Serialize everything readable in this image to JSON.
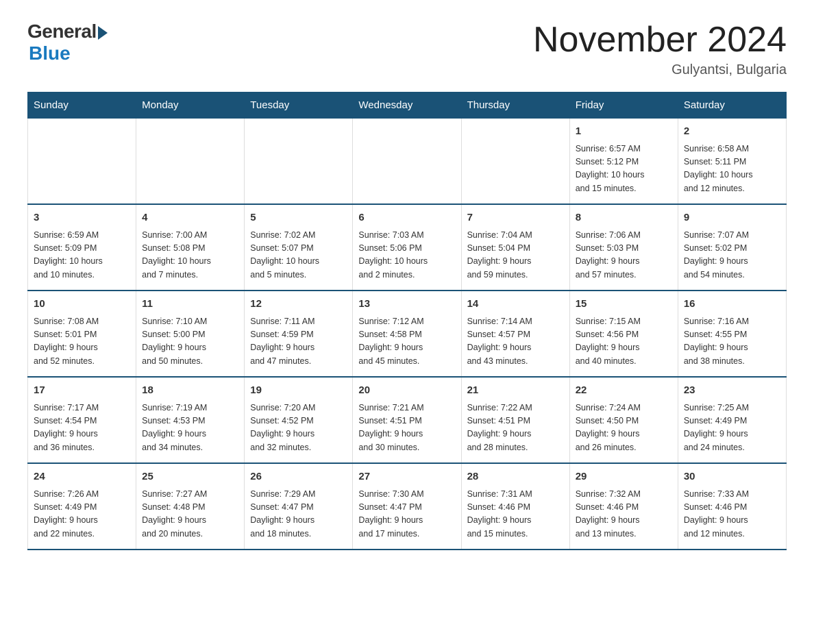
{
  "header": {
    "logo_general": "General",
    "logo_blue": "Blue",
    "title": "November 2024",
    "location": "Gulyantsi, Bulgaria"
  },
  "weekdays": [
    "Sunday",
    "Monday",
    "Tuesday",
    "Wednesday",
    "Thursday",
    "Friday",
    "Saturday"
  ],
  "weeks": [
    [
      {
        "day": "",
        "info": ""
      },
      {
        "day": "",
        "info": ""
      },
      {
        "day": "",
        "info": ""
      },
      {
        "day": "",
        "info": ""
      },
      {
        "day": "",
        "info": ""
      },
      {
        "day": "1",
        "info": "Sunrise: 6:57 AM\nSunset: 5:12 PM\nDaylight: 10 hours\nand 15 minutes."
      },
      {
        "day": "2",
        "info": "Sunrise: 6:58 AM\nSunset: 5:11 PM\nDaylight: 10 hours\nand 12 minutes."
      }
    ],
    [
      {
        "day": "3",
        "info": "Sunrise: 6:59 AM\nSunset: 5:09 PM\nDaylight: 10 hours\nand 10 minutes."
      },
      {
        "day": "4",
        "info": "Sunrise: 7:00 AM\nSunset: 5:08 PM\nDaylight: 10 hours\nand 7 minutes."
      },
      {
        "day": "5",
        "info": "Sunrise: 7:02 AM\nSunset: 5:07 PM\nDaylight: 10 hours\nand 5 minutes."
      },
      {
        "day": "6",
        "info": "Sunrise: 7:03 AM\nSunset: 5:06 PM\nDaylight: 10 hours\nand 2 minutes."
      },
      {
        "day": "7",
        "info": "Sunrise: 7:04 AM\nSunset: 5:04 PM\nDaylight: 9 hours\nand 59 minutes."
      },
      {
        "day": "8",
        "info": "Sunrise: 7:06 AM\nSunset: 5:03 PM\nDaylight: 9 hours\nand 57 minutes."
      },
      {
        "day": "9",
        "info": "Sunrise: 7:07 AM\nSunset: 5:02 PM\nDaylight: 9 hours\nand 54 minutes."
      }
    ],
    [
      {
        "day": "10",
        "info": "Sunrise: 7:08 AM\nSunset: 5:01 PM\nDaylight: 9 hours\nand 52 minutes."
      },
      {
        "day": "11",
        "info": "Sunrise: 7:10 AM\nSunset: 5:00 PM\nDaylight: 9 hours\nand 50 minutes."
      },
      {
        "day": "12",
        "info": "Sunrise: 7:11 AM\nSunset: 4:59 PM\nDaylight: 9 hours\nand 47 minutes."
      },
      {
        "day": "13",
        "info": "Sunrise: 7:12 AM\nSunset: 4:58 PM\nDaylight: 9 hours\nand 45 minutes."
      },
      {
        "day": "14",
        "info": "Sunrise: 7:14 AM\nSunset: 4:57 PM\nDaylight: 9 hours\nand 43 minutes."
      },
      {
        "day": "15",
        "info": "Sunrise: 7:15 AM\nSunset: 4:56 PM\nDaylight: 9 hours\nand 40 minutes."
      },
      {
        "day": "16",
        "info": "Sunrise: 7:16 AM\nSunset: 4:55 PM\nDaylight: 9 hours\nand 38 minutes."
      }
    ],
    [
      {
        "day": "17",
        "info": "Sunrise: 7:17 AM\nSunset: 4:54 PM\nDaylight: 9 hours\nand 36 minutes."
      },
      {
        "day": "18",
        "info": "Sunrise: 7:19 AM\nSunset: 4:53 PM\nDaylight: 9 hours\nand 34 minutes."
      },
      {
        "day": "19",
        "info": "Sunrise: 7:20 AM\nSunset: 4:52 PM\nDaylight: 9 hours\nand 32 minutes."
      },
      {
        "day": "20",
        "info": "Sunrise: 7:21 AM\nSunset: 4:51 PM\nDaylight: 9 hours\nand 30 minutes."
      },
      {
        "day": "21",
        "info": "Sunrise: 7:22 AM\nSunset: 4:51 PM\nDaylight: 9 hours\nand 28 minutes."
      },
      {
        "day": "22",
        "info": "Sunrise: 7:24 AM\nSunset: 4:50 PM\nDaylight: 9 hours\nand 26 minutes."
      },
      {
        "day": "23",
        "info": "Sunrise: 7:25 AM\nSunset: 4:49 PM\nDaylight: 9 hours\nand 24 minutes."
      }
    ],
    [
      {
        "day": "24",
        "info": "Sunrise: 7:26 AM\nSunset: 4:49 PM\nDaylight: 9 hours\nand 22 minutes."
      },
      {
        "day": "25",
        "info": "Sunrise: 7:27 AM\nSunset: 4:48 PM\nDaylight: 9 hours\nand 20 minutes."
      },
      {
        "day": "26",
        "info": "Sunrise: 7:29 AM\nSunset: 4:47 PM\nDaylight: 9 hours\nand 18 minutes."
      },
      {
        "day": "27",
        "info": "Sunrise: 7:30 AM\nSunset: 4:47 PM\nDaylight: 9 hours\nand 17 minutes."
      },
      {
        "day": "28",
        "info": "Sunrise: 7:31 AM\nSunset: 4:46 PM\nDaylight: 9 hours\nand 15 minutes."
      },
      {
        "day": "29",
        "info": "Sunrise: 7:32 AM\nSunset: 4:46 PM\nDaylight: 9 hours\nand 13 minutes."
      },
      {
        "day": "30",
        "info": "Sunrise: 7:33 AM\nSunset: 4:46 PM\nDaylight: 9 hours\nand 12 minutes."
      }
    ]
  ]
}
